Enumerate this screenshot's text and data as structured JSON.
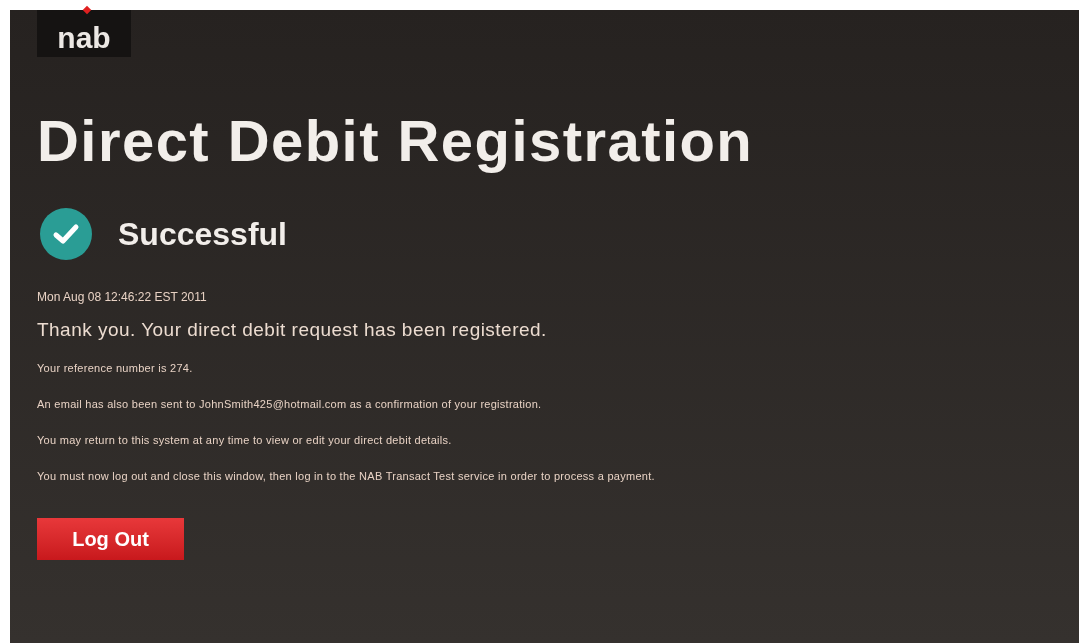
{
  "logo": {
    "text": "nab"
  },
  "title": "Direct Debit Registration",
  "status": {
    "kind": "success",
    "label": "Successful"
  },
  "timestamp": "Mon Aug 08 12:46:22 EST 2011",
  "headline": "Thank you. Your direct debit request has been registered.",
  "paragraphs": [
    "Your reference number is 274.",
    "An email has also been sent to JohnSmith425@hotmail.com as a confirmation of your registration.",
    "You may return to this system at any time to view or edit your direct debit details.",
    "You must now log out and close this window, then log in to the NAB Transact Test service in order to process a payment."
  ],
  "logout_button": "Log Out"
}
